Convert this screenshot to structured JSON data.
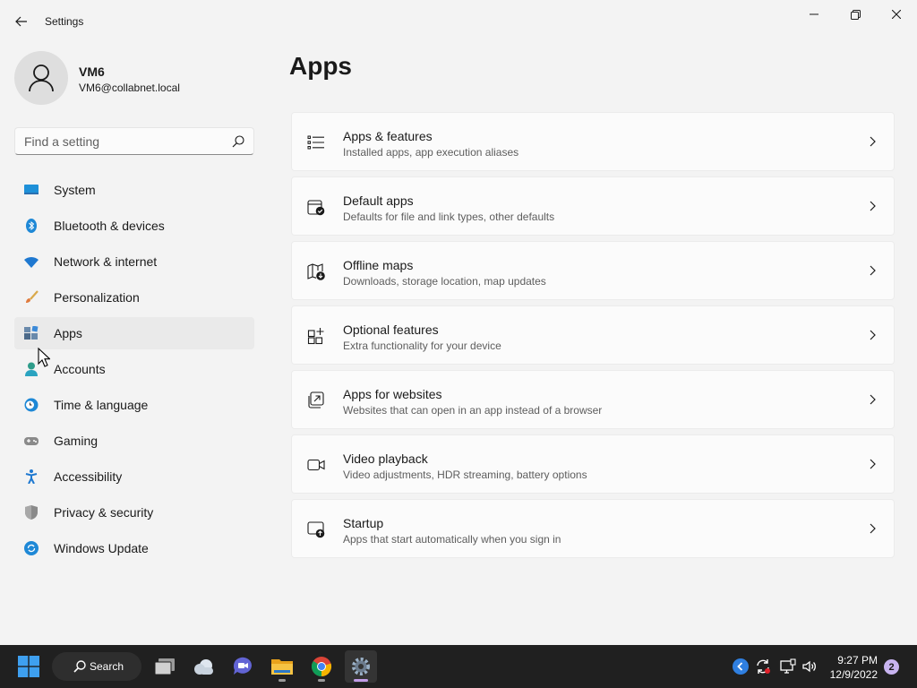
{
  "window": {
    "title": "Settings"
  },
  "profile": {
    "name": "VM6",
    "email": "VM6@collabnet.local"
  },
  "search": {
    "placeholder": "Find a setting",
    "value": ""
  },
  "nav": {
    "items": [
      {
        "label": "System",
        "icon": "system-icon"
      },
      {
        "label": "Bluetooth & devices",
        "icon": "bluetooth-icon"
      },
      {
        "label": "Network & internet",
        "icon": "wifi-icon"
      },
      {
        "label": "Personalization",
        "icon": "brush-icon"
      },
      {
        "label": "Apps",
        "icon": "apps-icon",
        "selected": true
      },
      {
        "label": "Accounts",
        "icon": "accounts-icon"
      },
      {
        "label": "Time & language",
        "icon": "clock-globe-icon"
      },
      {
        "label": "Gaming",
        "icon": "gamepad-icon"
      },
      {
        "label": "Accessibility",
        "icon": "accessibility-icon"
      },
      {
        "label": "Privacy & security",
        "icon": "shield-icon"
      },
      {
        "label": "Windows Update",
        "icon": "update-icon"
      }
    ]
  },
  "main": {
    "title": "Apps",
    "cards": [
      {
        "title": "Apps & features",
        "description": "Installed apps, app execution aliases",
        "icon": "list-icon"
      },
      {
        "title": "Default apps",
        "description": "Defaults for file and link types, other defaults",
        "icon": "default-apps-icon"
      },
      {
        "title": "Offline maps",
        "description": "Downloads, storage location, map updates",
        "icon": "map-download-icon"
      },
      {
        "title": "Optional features",
        "description": "Extra functionality for your device",
        "icon": "add-grid-icon"
      },
      {
        "title": "Apps for websites",
        "description": "Websites that can open in an app instead of a browser",
        "icon": "open-external-icon"
      },
      {
        "title": "Video playback",
        "description": "Video adjustments, HDR streaming, battery options",
        "icon": "video-icon"
      },
      {
        "title": "Startup",
        "description": "Apps that start automatically when you sign in",
        "icon": "startup-icon"
      }
    ]
  },
  "taskbar": {
    "search_label": "Search",
    "apps": [
      "task-view-icon",
      "weather-icon",
      "chat-icon",
      "file-explorer-icon",
      "chrome-icon",
      "settings-icon"
    ],
    "time": "9:27 PM",
    "date": "12/9/2022",
    "notification_count": "2"
  },
  "colors": {
    "accent": "#0067c0",
    "taskbar": "#202020",
    "background": "#f3f3f3"
  }
}
